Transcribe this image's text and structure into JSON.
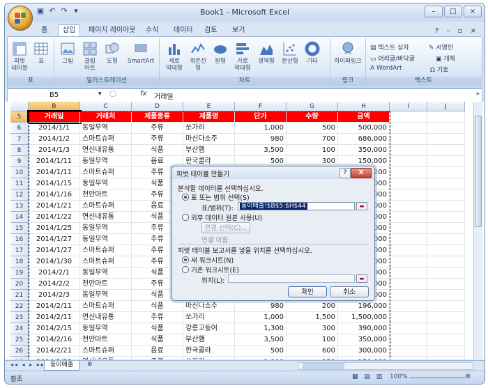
{
  "title": "Book1 - Microsoft Excel",
  "qat_icons": [
    "save-icon",
    "undo-icon",
    "redo-icon"
  ],
  "window_buttons": [
    "–",
    "□",
    "×"
  ],
  "tabs": [
    "홈",
    "삽입",
    "페이지 레이아웃",
    "수식",
    "데이터",
    "검토",
    "보기"
  ],
  "active_tab": "삽입",
  "tab_right": "? – ▫ ×",
  "ribbon": {
    "groups": [
      {
        "label": "표",
        "buttons": [
          "피벗\n테이블",
          "표"
        ]
      },
      {
        "label": "일러스트레이션",
        "buttons": [
          "그림",
          "클립\n아트",
          "도형",
          "SmartArt"
        ]
      },
      {
        "label": "차트",
        "buttons": [
          "세로\n막대형",
          "꺾은선형",
          "원형",
          "가로\n막대형",
          "영역형",
          "분산형",
          "기타"
        ]
      },
      {
        "label": "링크",
        "buttons": [
          "하이퍼링크"
        ]
      },
      {
        "label": "텍스트",
        "items": [
          "텍스트 상자",
          "서명란",
          "머리글/바닥글",
          "개체",
          "WordArt",
          "기호"
        ]
      }
    ]
  },
  "formula_bar": {
    "name_box": "B5",
    "fx": "fx",
    "value": "거래일"
  },
  "columns": [
    "B",
    "C",
    "D",
    "E",
    "F",
    "G",
    "H",
    "I",
    "J"
  ],
  "header_row": {
    "row": "5",
    "cells": [
      "거래일",
      "거래처",
      "제품종류",
      "제품명",
      "단가",
      "수량",
      "금액"
    ]
  },
  "rows": [
    {
      "row": "6",
      "cells": [
        "2014/1/1",
        "동일무역",
        "주류",
        "쏘가리",
        "1,000",
        "500",
        "500,000"
      ]
    },
    {
      "row": "7",
      "cells": [
        "2014/1/2",
        "스마트슈퍼",
        "주류",
        "마신다소주",
        "980",
        "700",
        "686,000"
      ]
    },
    {
      "row": "8",
      "cells": [
        "2014/1/3",
        "연신내유통",
        "식품",
        "부산햄",
        "3,500",
        "100",
        "350,000"
      ]
    },
    {
      "row": "9",
      "cells": [
        "2014/1/11",
        "동일무역",
        "음료",
        "한국콜라",
        "500",
        "300",
        "150,000"
      ]
    },
    {
      "row": "10",
      "cells": [
        "2014/1/11",
        "스마트슈퍼",
        "주류",
        "",
        "",
        "",
        "200"
      ]
    },
    {
      "row": "11",
      "cells": [
        "2014/1/15",
        "동일무역",
        "식품",
        "",
        "",
        "",
        "000"
      ]
    },
    {
      "row": "12",
      "cells": [
        "2014/1/16",
        "천만마트",
        "주류",
        "",
        "",
        "",
        "000"
      ]
    },
    {
      "row": "13",
      "cells": [
        "2014/1/21",
        "스마트슈퍼",
        "음료",
        "",
        "",
        "",
        "000"
      ]
    },
    {
      "row": "14",
      "cells": [
        "2014/1/22",
        "연신내유통",
        "식품",
        "",
        "",
        "",
        "000"
      ]
    },
    {
      "row": "15",
      "cells": [
        "2014/1/25",
        "동일무역",
        "주류",
        "",
        "",
        "",
        "000"
      ]
    },
    {
      "row": "16",
      "cells": [
        "2014/1/27",
        "동일무역",
        "주류",
        "",
        "",
        "",
        "000"
      ]
    },
    {
      "row": "17",
      "cells": [
        "2014/1/27",
        "스마트슈퍼",
        "주류",
        "",
        "",
        "",
        "000"
      ]
    },
    {
      "row": "18",
      "cells": [
        "2014/1/30",
        "스마트슈퍼",
        "주류",
        "",
        "",
        "",
        "000"
      ]
    },
    {
      "row": "19",
      "cells": [
        "2014/2/1",
        "동일무역",
        "식품",
        "",
        "",
        "",
        "000"
      ]
    },
    {
      "row": "20",
      "cells": [
        "2014/2/2",
        "천만마트",
        "주류",
        "",
        "",
        "",
        "000"
      ]
    },
    {
      "row": "21",
      "cells": [
        "2014/2/3",
        "동일무역",
        "식품",
        "",
        "",
        "",
        "000"
      ]
    },
    {
      "row": "22",
      "cells": [
        "2014/2/11",
        "스마트슈퍼",
        "식품",
        "마신다소주",
        "980",
        "200",
        "196,000"
      ]
    },
    {
      "row": "23",
      "cells": [
        "2014/2/11",
        "연신내유통",
        "주류",
        "쏘가리",
        "1,000",
        "1,500",
        "1,500,000"
      ]
    },
    {
      "row": "24",
      "cells": [
        "2014/2/15",
        "동일무역",
        "식품",
        "강릉고등어",
        "1,300",
        "300",
        "390,000"
      ]
    },
    {
      "row": "25",
      "cells": [
        "2014/2/16",
        "천만마트",
        "식품",
        "부산햄",
        "3,500",
        "100",
        "350,000"
      ]
    },
    {
      "row": "26",
      "cells": [
        "2014/2/21",
        "스마트슈퍼",
        "음료",
        "한국콜라",
        "500",
        "600",
        "300,000"
      ]
    },
    {
      "row": "27",
      "cells": [
        "2014/2/22",
        "연신내유통",
        "주류",
        "쏘가리",
        "1,000",
        "150",
        "150,000"
      ]
    }
  ],
  "sheet_tab": "동이매출",
  "status_text": "참조",
  "zoom": "100%",
  "dialog": {
    "title": "피벗 테이블 만들기",
    "help": "?",
    "close": "X",
    "section1": "분석할 데이터를 선택하십시오.",
    "opt_table": "표 또는 범위 선택(S)",
    "range_label": "표/범위(T):",
    "range_value": "동이매출!$B$5:$H$44",
    "opt_external": "외부 데이터 원본 사용(U)",
    "conn_button": "연결 선택(C)...",
    "conn_name": "연결 이름:",
    "section2": "피벗 테이블 보고서를 넣을 위치를 선택하십시오.",
    "opt_new": "새 워크시트(N)",
    "opt_existing": "기존 워크시트(E)",
    "location_label": "위치(L):",
    "location_value": "",
    "ok": "확인",
    "cancel": "취소"
  },
  "colors": {
    "header_fill": "#ff0000",
    "header_text": "#ffffff",
    "accent": "#1f4e9a"
  }
}
